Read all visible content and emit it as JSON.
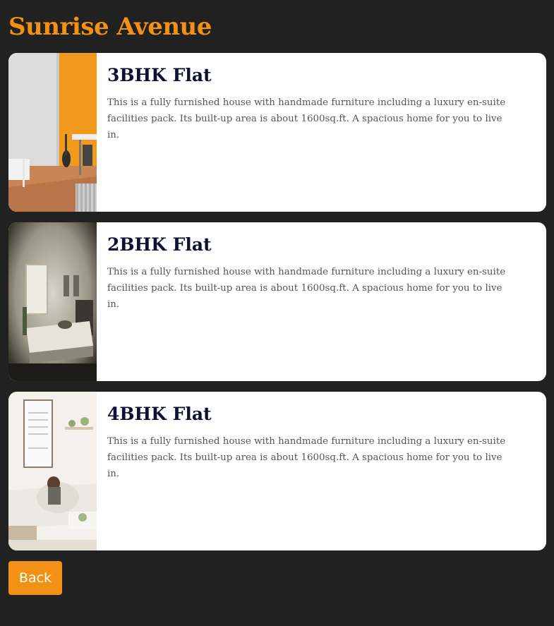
{
  "page": {
    "title": "Sunrise Avenue"
  },
  "listings": [
    {
      "title": "3BHK Flat",
      "description": "This is a fully furnished house with handmade furniture including a luxury en-suite facilities pack. Its built-up area is about 1600sq.ft. A spacious home for you to live in.",
      "image": "room-with-orange-wall-photo"
    },
    {
      "title": "2BHK Flat",
      "description": "This is a fully furnished house with handmade furniture including a luxury en-suite facilities pack. Its built-up area is about 1600sq.ft. A spacious home for you to live in.",
      "image": "bedroom-photo"
    },
    {
      "title": "4BHK Flat",
      "description": "This is a fully furnished house with handmade furniture including a luxury en-suite facilities pack. Its built-up area is about 1600sq.ft. A spacious home for you to live in.",
      "image": "living-room-photo"
    }
  ],
  "actions": {
    "back_label": "Back"
  },
  "colors": {
    "background": "#212121",
    "accent": "#f39016",
    "card": "#ffffff",
    "title_text": "#0e1033",
    "body_text": "#555555"
  }
}
